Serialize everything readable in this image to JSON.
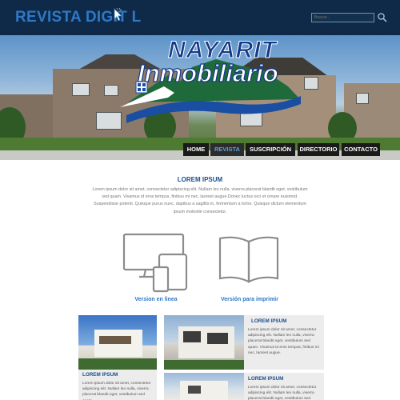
{
  "header": {
    "logo_text": "REVISTA DIGIT L",
    "search_placeholder": "Buscar..."
  },
  "brand": {
    "line1": "NAYARIT",
    "line2": "Inmobiliario"
  },
  "nav": [
    {
      "label": "HOME",
      "active": false
    },
    {
      "label": "REVISTA",
      "active": true
    },
    {
      "label": "SUSCRIPCIÓN",
      "active": false
    },
    {
      "label": "DIRECTORIO",
      "active": false
    },
    {
      "label": "CONTACTO",
      "active": false
    }
  ],
  "intro": {
    "title": "LOREM IPSUM",
    "body": "Lorem ipsum dolor sit amet, consectetur adipiscing elit. Nullam leo nulla, viverra placerat blandit eget, vestibulum sed quam. Vivamus id eros tempus, finibus mi nec, laoreet augue.Donec luctus orci et ornare euismod. Suspendisse potenti. Quisque purus nunc, dapibus a sagittis in, fermentum a tortor. Quisque dictum elementum ipsum molestie consectetur."
  },
  "downloads": [
    {
      "label": "Version en linea",
      "icon": "devices-icon"
    },
    {
      "label": "Versión para imprimir",
      "icon": "open-book-icon"
    }
  ],
  "cards": [
    {
      "title": "LOREM IPSUM",
      "text": "Lorem ipsum dolor sit amet, consectetur adipiscing elit. Nullam leo nulla, viverra placerat blandit eget, vestibulum sed quam."
    },
    {
      "title": "LOREM IPSUM",
      "text": "Lorem ipsum dolor sit amet, consectetur adipiscing elit. Nullam leo nulla, viverra placerat blandit eget, vestibulum sed quam. Vivamus id eros tempus, finibus mi nec, laoreet augue."
    },
    {
      "title": "LOREM IPSUM",
      "text": "Lorem ipsum dolor sit amet, consectetur adipiscing elit. Nullam leo nulla, viverra placerat blandit eget, vestibulum sed quam."
    }
  ],
  "colors": {
    "header_bg": "#0f2a48",
    "accent": "#2e78c7",
    "title_blue": "#1a4f8a",
    "nav_bg": "#1a1a1a"
  }
}
